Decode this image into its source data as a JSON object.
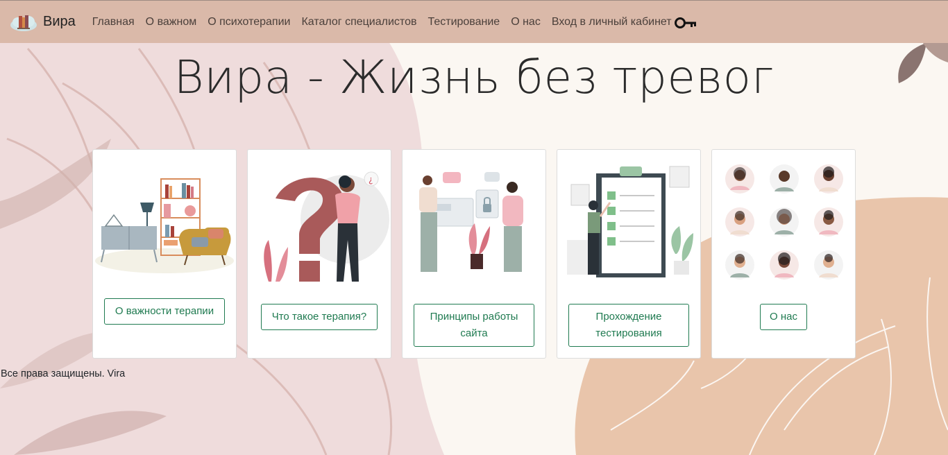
{
  "brand": {
    "name": "Вира",
    "logo_icon": "books-cloud-logo-icon"
  },
  "nav": {
    "items": [
      {
        "label": "Главная"
      },
      {
        "label": "О важном"
      },
      {
        "label": "О психотерапии"
      },
      {
        "label": "Каталог специалистов"
      },
      {
        "label": "Тестирование"
      },
      {
        "label": "О нас"
      }
    ],
    "login_label": "Вход в личный кабинет",
    "login_icon": "key-icon"
  },
  "hero": {
    "title": "Вира - Жизнь без тревог"
  },
  "cards": [
    {
      "button": "О важности терапии",
      "illustration": "living-room-illustration"
    },
    {
      "button": "Что такое терапия?",
      "illustration": "question-mark-person-illustration"
    },
    {
      "button": "Принципы работы сайта",
      "illustration": "security-privacy-illustration"
    },
    {
      "button": "Прохождение тестирования",
      "illustration": "checklist-illustration"
    },
    {
      "button": "О нас",
      "illustration": "team-avatars-illustration"
    }
  ],
  "footer": {
    "text": "Все права защищены. Vira"
  },
  "colors": {
    "navbar": "#dab9a9",
    "accent_green": "#1f7a50",
    "bg_pink": "#efdcdc",
    "bg_peach": "#e9c5ab"
  }
}
